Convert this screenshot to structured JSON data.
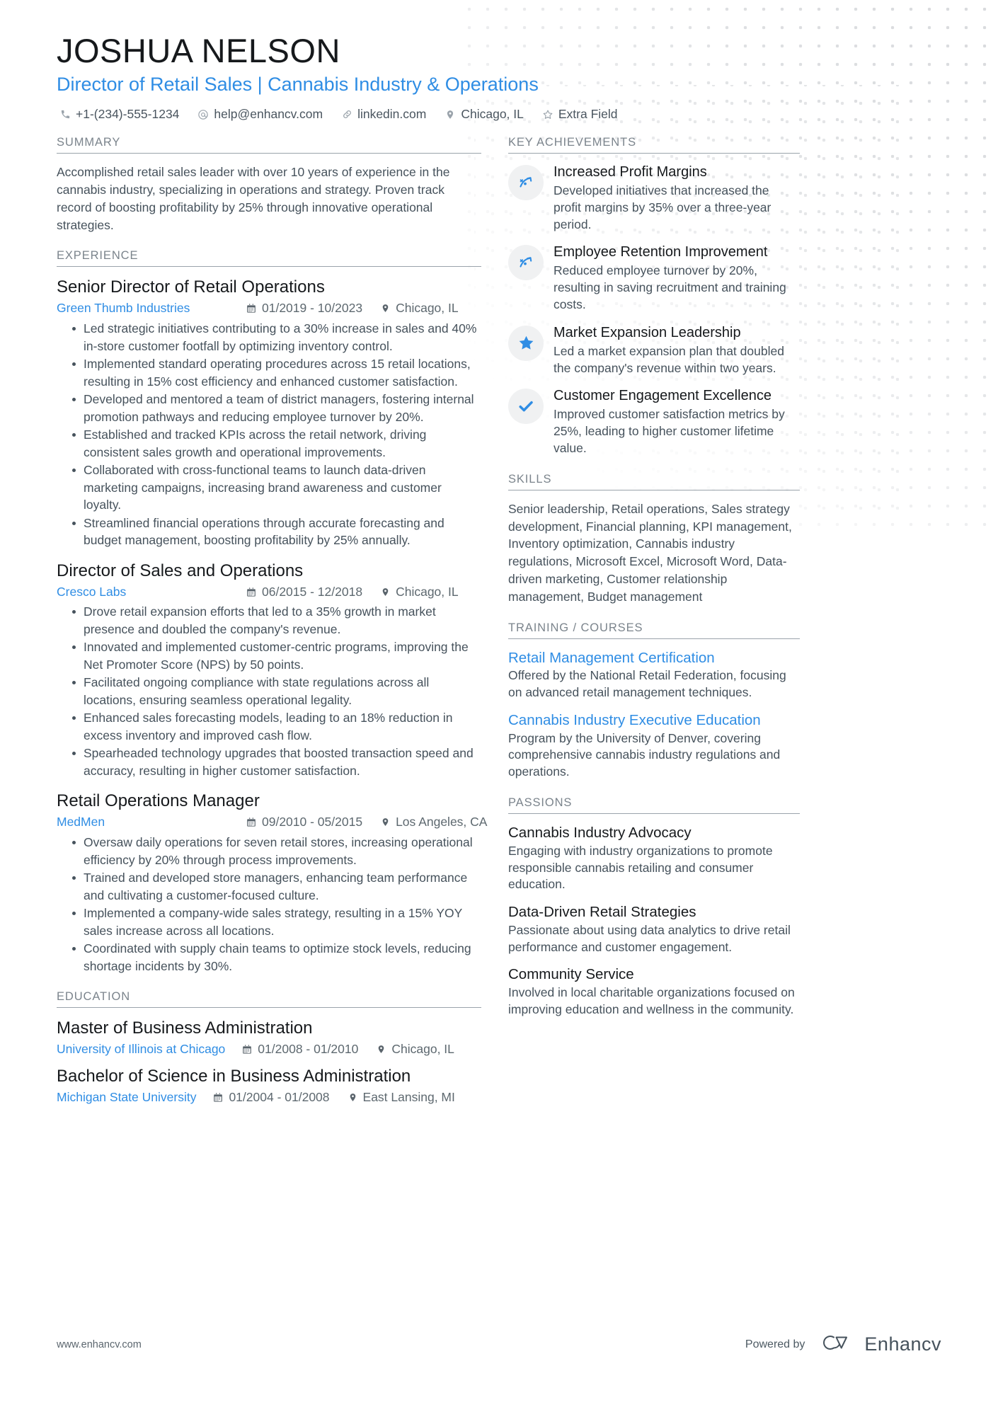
{
  "header": {
    "name": "JOSHUA NELSON",
    "headline": "Director of Retail Sales | Cannabis Industry & Operations",
    "contacts": [
      {
        "icon": "phone-icon",
        "text": "+1-(234)-555-1234"
      },
      {
        "icon": "email-icon",
        "text": "help@enhancv.com"
      },
      {
        "icon": "link-icon",
        "text": "linkedin.com"
      },
      {
        "icon": "location-pin-icon",
        "text": "Chicago, IL"
      },
      {
        "icon": "star-outline-icon",
        "text": "Extra Field"
      }
    ]
  },
  "summary": {
    "title": "SUMMARY",
    "text": "Accomplished retail sales leader with over 10 years of experience in the cannabis industry, specializing in operations and strategy. Proven track record of boosting profitability by 25% through innovative operational strategies."
  },
  "experience": {
    "title": "EXPERIENCE",
    "jobs": [
      {
        "role": "Senior Director of Retail Operations",
        "company": "Green Thumb Industries",
        "dates": "01/2019 - 10/2023",
        "location": "Chicago, IL",
        "bullets": [
          "Led strategic initiatives contributing to a 30% increase in sales and 40% in-store customer footfall by optimizing inventory control.",
          "Implemented standard operating procedures across 15 retail locations, resulting in 15% cost efficiency and enhanced customer satisfaction.",
          "Developed and mentored a team of district managers, fostering internal promotion pathways and reducing employee turnover by 20%.",
          "Established and tracked KPIs across the retail network, driving consistent sales growth and operational improvements.",
          "Collaborated with cross-functional teams to launch data-driven marketing campaigns, increasing brand awareness and customer loyalty.",
          "Streamlined financial operations through accurate forecasting and budget management, boosting profitability by 25% annually."
        ]
      },
      {
        "role": "Director of Sales and Operations",
        "company": "Cresco Labs",
        "dates": "06/2015 - 12/2018",
        "location": "Chicago, IL",
        "bullets": [
          "Drove retail expansion efforts that led to a 35% growth in market presence and doubled the company's revenue.",
          "Innovated and implemented customer-centric programs, improving the Net Promoter Score (NPS) by 50 points.",
          "Facilitated ongoing compliance with state regulations across all locations, ensuring seamless operational legality.",
          "Enhanced sales forecasting models, leading to an 18% reduction in excess inventory and improved cash flow.",
          "Spearheaded technology upgrades that boosted transaction speed and accuracy, resulting in higher customer satisfaction."
        ]
      },
      {
        "role": "Retail Operations Manager",
        "company": "MedMen",
        "dates": "09/2010 - 05/2015",
        "location": "Los Angeles, CA",
        "bullets": [
          "Oversaw daily operations for seven retail stores, increasing operational efficiency by 20% through process improvements.",
          "Trained and developed store managers, enhancing team performance and cultivating a customer-focused culture.",
          "Implemented a company-wide sales strategy, resulting in a 15% YOY sales increase across all locations.",
          "Coordinated with supply chain teams to optimize stock levels, reducing shortage incidents by 30%."
        ]
      }
    ]
  },
  "education": {
    "title": "EDUCATION",
    "entries": [
      {
        "degree": "Master of Business Administration",
        "school": "University of Illinois at Chicago",
        "dates": "01/2008 - 01/2010",
        "location": "Chicago, IL"
      },
      {
        "degree": "Bachelor of Science in Business Administration",
        "school": "Michigan State University",
        "dates": "01/2004 - 01/2008",
        "location": "East Lansing, MI"
      }
    ]
  },
  "key_achievements": {
    "title": "KEY ACHIEVEMENTS",
    "items": [
      {
        "icon": "trending-up-icon",
        "title": "Increased Profit Margins",
        "desc": "Developed initiatives that increased the profit margins by 35% over a three-year period."
      },
      {
        "icon": "trending-up-icon",
        "title": "Employee Retention Improvement",
        "desc": "Reduced employee turnover by 20%, resulting in saving recruitment and training costs."
      },
      {
        "icon": "star-filled-icon",
        "title": "Market Expansion Leadership",
        "desc": "Led a market expansion plan that doubled the company's revenue within two years."
      },
      {
        "icon": "check-icon",
        "title": "Customer Engagement Excellence",
        "desc": "Improved customer satisfaction metrics by 25%, leading to higher customer lifetime value."
      }
    ]
  },
  "skills": {
    "title": "SKILLS",
    "text": "Senior leadership, Retail operations, Sales strategy development, Financial planning, KPI management, Inventory optimization, Cannabis industry regulations, Microsoft Excel, Microsoft Word, Data-driven marketing, Customer relationship management, Budget management"
  },
  "training": {
    "title": "TRAINING / COURSES",
    "items": [
      {
        "name": "Retail Management Certification",
        "desc": "Offered by the National Retail Federation, focusing on advanced retail management techniques."
      },
      {
        "name": "Cannabis Industry Executive Education",
        "desc": "Program by the University of Denver, covering comprehensive cannabis industry regulations and operations."
      }
    ]
  },
  "passions": {
    "title": "PASSIONS",
    "items": [
      {
        "name": "Cannabis Industry Advocacy",
        "desc": "Engaging with industry organizations to promote responsible cannabis retailing and consumer education."
      },
      {
        "name": "Data-Driven Retail Strategies",
        "desc": "Passionate about using data analytics to drive retail performance and customer engagement."
      },
      {
        "name": "Community Service",
        "desc": "Involved in local charitable organizations focused on improving education and wellness in the community."
      }
    ]
  },
  "footer": {
    "url": "www.enhancv.com",
    "powered_by": "Powered by",
    "brand": "Enhancv"
  },
  "colors": {
    "accent": "#2f8de4",
    "text": "#46525c",
    "heading": "#16191c",
    "section_label": "#7b848c"
  }
}
